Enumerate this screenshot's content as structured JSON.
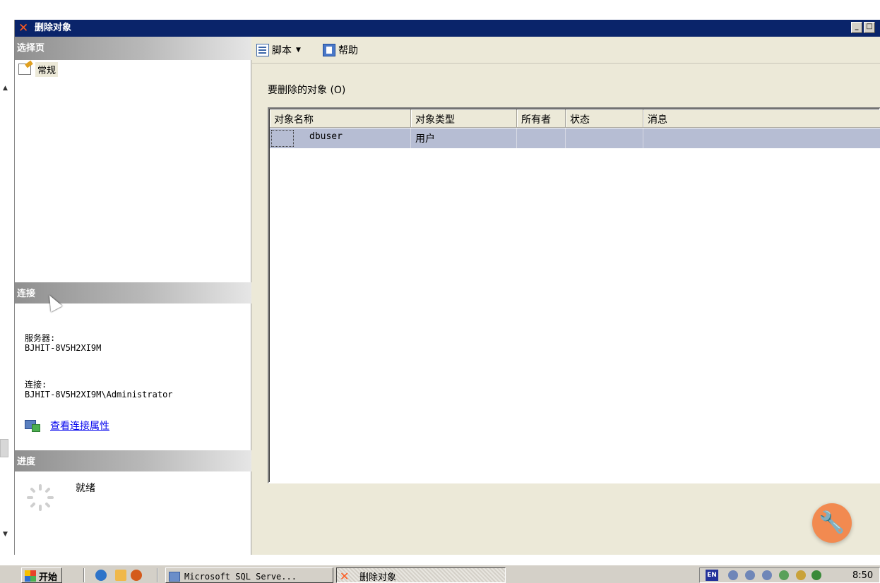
{
  "dialog": {
    "title": "删除对象",
    "title_icon": "delete-x-icon",
    "min_label": "_",
    "max_label": "□"
  },
  "left_panel": {
    "select_page_header": "选择页",
    "pages": [
      {
        "label": "常规",
        "icon": "general-page-icon"
      }
    ],
    "connection_header": "连接",
    "server_label": "服务器:",
    "server_value": "BJHIT-8V5H2XI9M",
    "connection_label": "连接:",
    "connection_value": "BJHIT-8V5H2XI9M\\Administrator",
    "view_connection_properties": "查看连接属性",
    "progress_header": "进度",
    "progress_status": "就绪"
  },
  "toolbar": {
    "script_label": "脚本",
    "help_label": "帮助"
  },
  "main": {
    "objects_label": "要删除的对象 (O)",
    "columns": [
      "对象名称",
      "对象类型",
      "所有者",
      "状态",
      "消息"
    ],
    "rows": [
      {
        "name": "dbuser",
        "type": "用户",
        "owner": "",
        "status": "",
        "message": ""
      }
    ]
  },
  "taskbar": {
    "start_label": "开始",
    "tasks": [
      "Microsoft SQL Serve...",
      "删除对象"
    ],
    "lang": "EN",
    "clock": "8:50"
  },
  "colors": {
    "title_bar": "#0a246a",
    "dialog_bg": "#ece9d8",
    "selected_row": "#b6bdd3",
    "link": "#0000ee",
    "fab": "#f28a50"
  }
}
